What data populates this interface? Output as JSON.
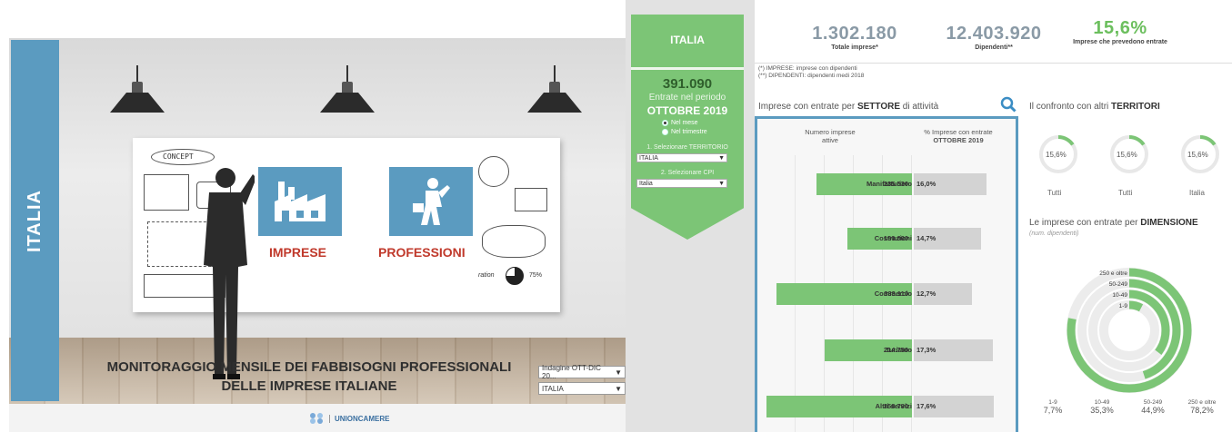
{
  "landing": {
    "strip_label": "ITALIA",
    "title_line1": "MONITORAGGIO MENSILE DEI FABBISOGNI PROFESSIONALI",
    "title_line2": "DELLE IMPRESE ITALIANE",
    "card_imprese": "IMPRESE",
    "card_professioni": "PROFESSIONI",
    "select_indagine": "Indagine OTT-DIC 20...",
    "select_territorio": "ITALIA",
    "brand": "UNIONCAMERE",
    "whiteboard_text": {
      "concept": "CONCEPT",
      "ration": "ration",
      "pct": "75%"
    }
  },
  "dashboard": {
    "ribbon": {
      "title": "ITALIA",
      "entrate_value": "391.090",
      "entrate_label": "Entrate nel periodo",
      "period": "OTTOBRE 2019",
      "radio_options": [
        {
          "label": "Nel mese",
          "checked": true
        },
        {
          "label": "Nel trimestre",
          "checked": false
        }
      ],
      "select_territorio_label": "1. Selezionare TERRITORIO",
      "select_territorio_value": "ITALIA",
      "select_cpi_label": "2. Selezionare CPI",
      "select_cpi_value": "Italia"
    },
    "kpis": [
      {
        "value": "1.302.180",
        "label": "Totale imprese*"
      },
      {
        "value": "12.403.920",
        "label": "Dipendenti**"
      },
      {
        "value": "15,6%",
        "label": "Imprese che prevedono entrate"
      }
    ],
    "notes": [
      "(*)  IMPRESE: imprese con dipendenti",
      "(**) DIPENDENTI: dipendenti medi 2018"
    ],
    "sector_section": {
      "title_pre": "Imprese con entrate per ",
      "title_bold": "SETTORE",
      "title_post": " di attività",
      "col_left_line1": "Numero imprese",
      "col_left_line2": "attive",
      "col_right_line1": "% Imprese con entrate",
      "col_right_line2": "OTTOBRE 2019"
    },
    "territori_section": {
      "title_pre": "Il confronto con altri ",
      "title_bold": "TERRITORI",
      "items": [
        {
          "pct": "15,6%",
          "label": "Tutti",
          "fraction": 0.156
        },
        {
          "pct": "15,6%",
          "label": "Tutti",
          "fraction": 0.156
        },
        {
          "pct": "15,6%",
          "label": "Italia",
          "fraction": 0.156
        }
      ]
    },
    "dim_section": {
      "title_pre": "Le imprese con entrate per ",
      "title_bold": "DIMENSIONE",
      "subtitle": "(num. dipendenti)"
    },
    "colors": {
      "green": "#7cc576",
      "blue": "#5b9bc0",
      "grey": "#d3d3d3"
    }
  },
  "chart_data": [
    {
      "type": "bar",
      "title": "Imprese con entrate per SETTORE di attività",
      "categories": [
        "Manifatturiero",
        "Costruzioni",
        "Commercio",
        "Turismo",
        "Altri servizi"
      ],
      "series": [
        {
          "name": "Numero imprese attive",
          "values": [
            235530,
            160000,
            333110,
            214750,
            358780
          ],
          "labels": [
            "235.530",
            "160.000",
            "333.110",
            "214.750",
            "358.780"
          ]
        },
        {
          "name": "% Imprese con entrate OTTOBRE 2019",
          "values": [
            16.0,
            14.7,
            12.7,
            17.3,
            17.6
          ],
          "labels": [
            "16,0%",
            "14,7%",
            "12,7%",
            "17,3%",
            "17,6%"
          ]
        }
      ]
    },
    {
      "type": "pie",
      "title": "Le imprese con entrate per DIMENSIONE",
      "categories": [
        "1-9",
        "10-49",
        "50-249",
        "250 e oltre"
      ],
      "values": [
        7.7,
        35.3,
        44.9,
        78.2
      ],
      "labels": [
        "7,7%",
        "35,3%",
        "44,9%",
        "78,2%"
      ]
    }
  ]
}
